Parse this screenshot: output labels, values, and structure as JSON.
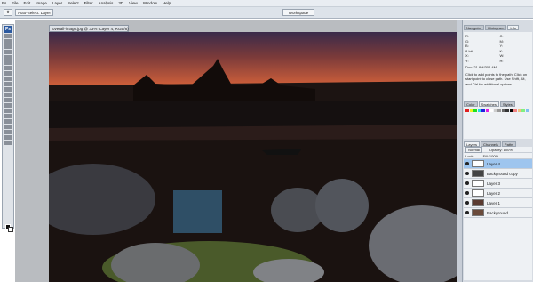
{
  "menubar": {
    "items": [
      "Ps",
      "File",
      "Edit",
      "Image",
      "Layer",
      "Select",
      "Filter",
      "Analysis",
      "3D",
      "View",
      "Window",
      "Help"
    ]
  },
  "options": {
    "auto_select": "Auto-Select: Layer",
    "workspace": "Workspace"
  },
  "document": {
    "tab_title": "overall-image.jpg @ 33% (Layer 4, RGB/8)"
  },
  "panels": {
    "top_tabs": [
      "Navigator",
      "Histogram",
      "Info"
    ],
    "info_text": "Click to add points to the path. Click on start point to close path. Use Shift, Alt, and Ctrl for additional options.",
    "info_values": [
      "R:",
      "G:",
      "B:",
      "C:",
      "M:",
      "Y:",
      "K:",
      "8-bit",
      "X:",
      "Y:",
      "W:",
      "H:"
    ],
    "doc_info": "Doc: 21.8M/304.4M",
    "mid_tabs": [
      "Color",
      "Swatches",
      "Styles"
    ],
    "layer_tabs": [
      "Layers",
      "Channels",
      "Paths"
    ],
    "blend_mode": "Normal",
    "opacity": "Opacity: 100%",
    "lock_label": "Lock:",
    "fill": "Fill: 100%",
    "layers": [
      {
        "name": "Layer 4",
        "selected": true
      },
      {
        "name": "Background copy",
        "selected": false
      },
      {
        "name": "Layer 3",
        "selected": false
      },
      {
        "name": "Layer 2",
        "selected": false
      },
      {
        "name": "Layer 1",
        "selected": false
      },
      {
        "name": "Background",
        "selected": false
      }
    ]
  },
  "colors": {
    "accent": "#2c5aa0",
    "selection": "#9ec5ee"
  }
}
